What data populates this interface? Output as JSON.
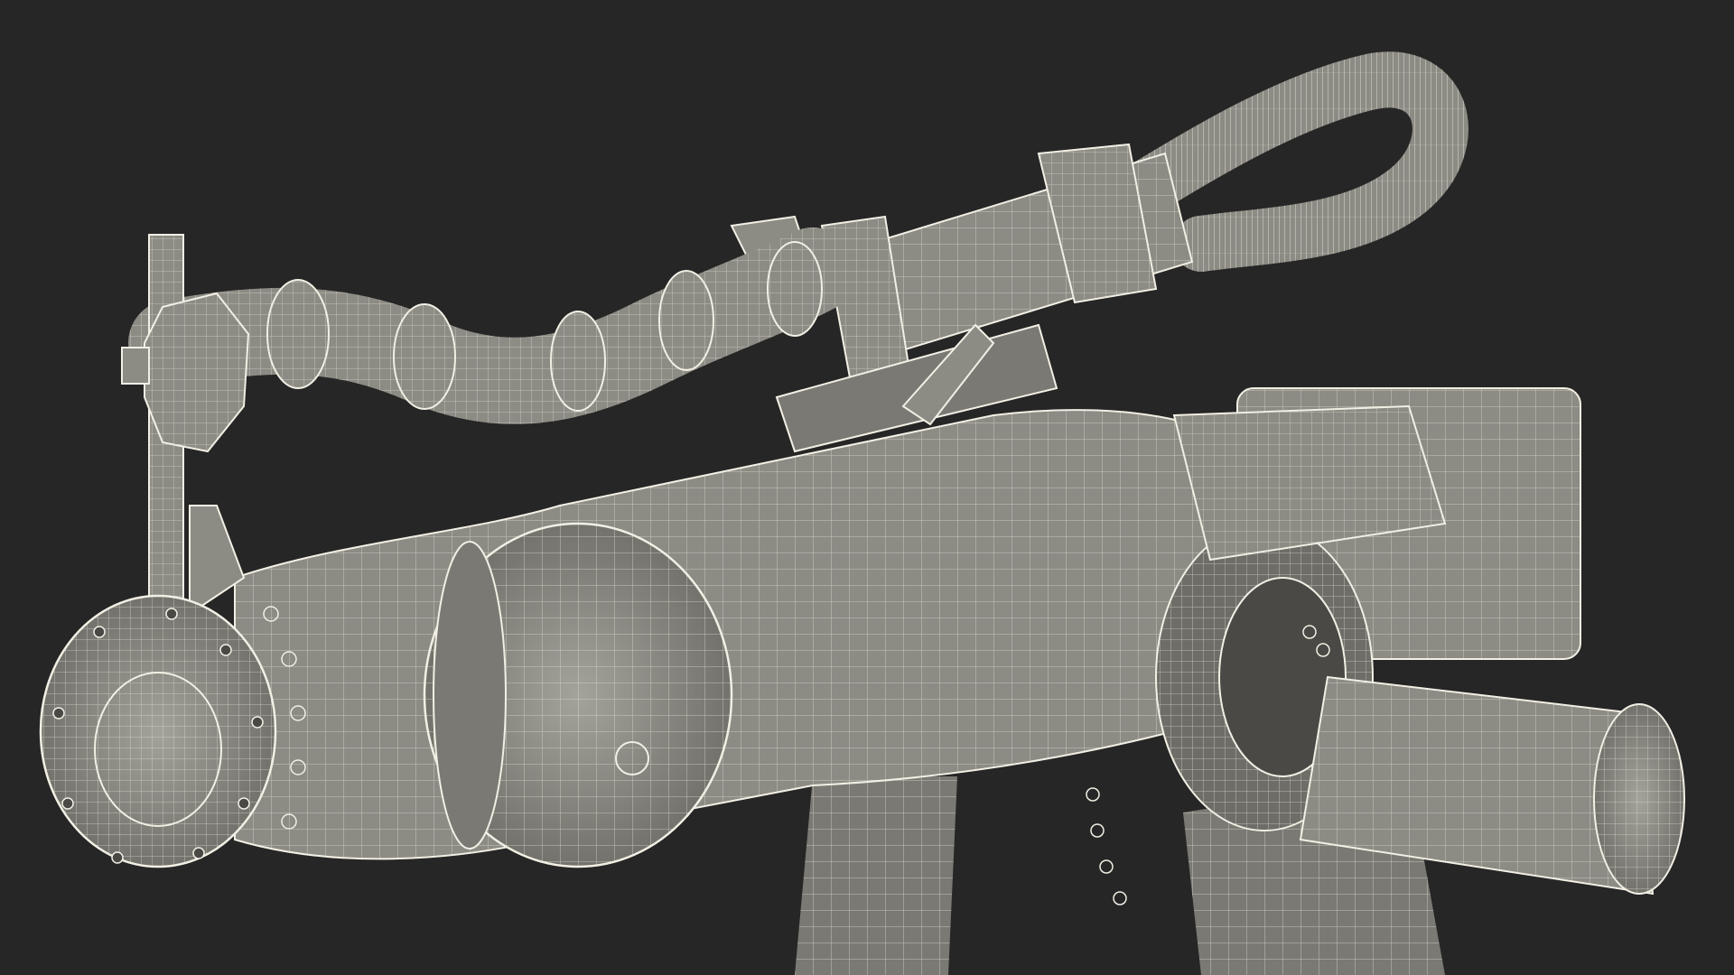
{
  "scene": {
    "background_color": "#262626",
    "surface_color": "#8c8b84",
    "surface_shadow_color": "#6e6d67",
    "surface_highlight_color": "#a4a39b",
    "wire_color": "#dedbcf",
    "edge_color": "#f2efe4",
    "view": "wireframe-over-shaded",
    "subject": "robot-arm-wrist-assembly"
  }
}
